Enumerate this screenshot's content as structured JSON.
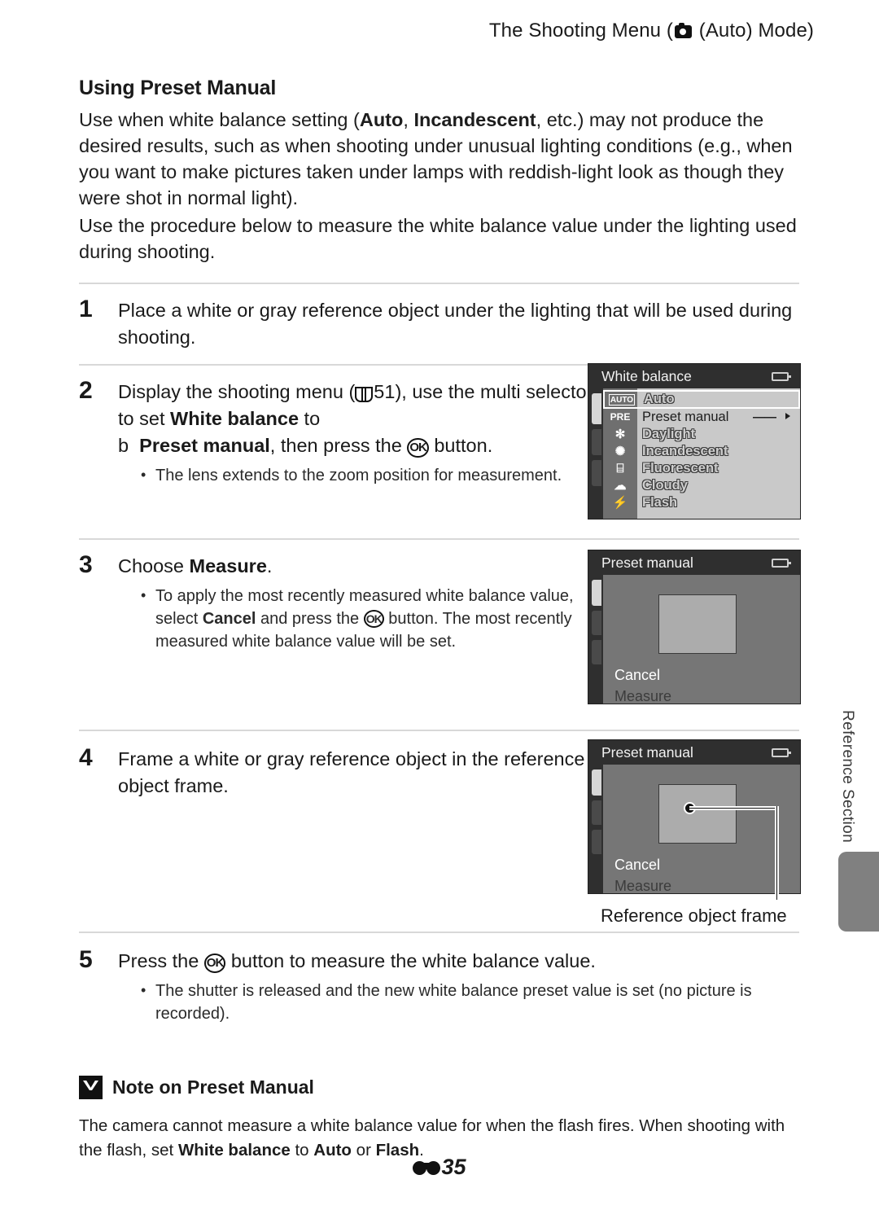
{
  "header": {
    "prefix": "The Shooting Menu (",
    "camera_icon": "camera-icon",
    "suffix": " (Auto) Mode)"
  },
  "section": {
    "title": "Using Preset Manual",
    "intro_1_a": "Use when white balance setting (",
    "intro_1_b1": "Auto",
    "intro_1_c": ", ",
    "intro_1_b2": "Incandescent",
    "intro_1_d": ", etc.) may not produce the desired results, such as when shooting under unusual lighting conditions (e.g., when you want to make pictures taken under lamps with reddish-light look as though they were shot in normal light).",
    "intro_2": "Use the procedure below to measure the white balance value under the lighting used during shooting."
  },
  "steps": [
    {
      "num": "1",
      "text": "Place a white or gray reference object under the lighting that will be used during shooting."
    },
    {
      "num": "2",
      "line1": "Display the shooting menu (",
      "page_ref": "51",
      "line1b": "), use the",
      "line2a": "multi selector to set ",
      "line2b": "White balance",
      "line2c": " to",
      "line3a": "b",
      "line3b": "Preset manual",
      "line3c": ", then press the ",
      "line3d": " button.",
      "bullets": [
        "The lens extends to the zoom position for measurement."
      ]
    },
    {
      "num": "3",
      "line1a": "Choose ",
      "line1b": "Measure",
      "line1c": ".",
      "bullet_a": "To apply the most recently measured white balance value, select ",
      "bullet_b": "Cancel",
      "bullet_c": " and press the ",
      "bullet_d": " button. The most recently measured white balance value will be set."
    },
    {
      "num": "4",
      "text": "Frame a white or gray reference object in the reference object frame."
    },
    {
      "num": "5",
      "line1a": "Press the ",
      "line1b": " button to measure the white balance value.",
      "bullets": [
        "The shutter is released and the new white balance preset value is set (no picture is recorded)."
      ]
    }
  ],
  "wb_screen": {
    "title": "White balance",
    "battery_icon": "battery-icon",
    "rows": [
      {
        "icon": "AUTO",
        "icon_name": "auto-wb-icon",
        "label": "Auto",
        "selected": true
      },
      {
        "icon": "PRE",
        "icon_name": "preset-wb-icon",
        "label": "Preset manual",
        "dashes": "——",
        "arrow": true,
        "plain": true
      },
      {
        "icon": "✻",
        "icon_name": "daylight-icon",
        "label": "Daylight"
      },
      {
        "icon": "✺",
        "icon_name": "incandescent-icon",
        "label": "Incandescent"
      },
      {
        "icon": "⌸",
        "icon_name": "fluorescent-icon",
        "label": "Fluorescent"
      },
      {
        "icon": "☁",
        "icon_name": "cloudy-icon",
        "label": "Cloudy"
      },
      {
        "icon": "⚡",
        "icon_name": "flash-icon",
        "label": "Flash"
      }
    ]
  },
  "pm_screen_1": {
    "title": "Preset manual",
    "battery_icon": "battery-icon",
    "cancel": "Cancel",
    "measure": "Measure"
  },
  "pm_screen_2": {
    "title": "Preset manual",
    "battery_icon": "battery-icon",
    "cancel": "Cancel",
    "measure": "Measure",
    "callout_label": "Reference object frame"
  },
  "side_tab": {
    "label": "Reference Section"
  },
  "note": {
    "icon_name": "caution-icon",
    "title": "Note on Preset Manual",
    "body_a": "The camera cannot measure a white balance value for when the flash fires. When shooting with the flash, set ",
    "body_b": "White balance",
    "body_c": " to ",
    "body_d": "Auto",
    "body_e": " or ",
    "body_f": "Flash",
    "body_g": "."
  },
  "folio": {
    "icon_name": "reference-section-icon",
    "page": "35"
  }
}
